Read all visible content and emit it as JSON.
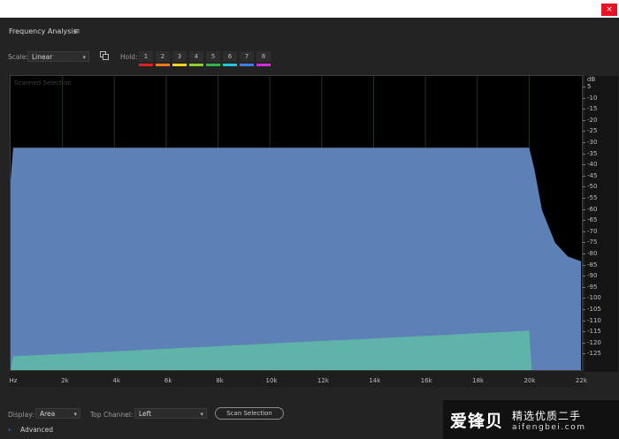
{
  "window": {
    "close_glyph": "×"
  },
  "panel": {
    "title": "Frequency Analysis",
    "menu_icon": "≡"
  },
  "controls": {
    "scale_label": "Scale:",
    "scale_value": "Linear",
    "hold_label": "Hold:",
    "hold_buttons": [
      {
        "label": "1",
        "color": "#e0201c"
      },
      {
        "label": "2",
        "color": "#f07a1a"
      },
      {
        "label": "3",
        "color": "#f2d21a"
      },
      {
        "label": "4",
        "color": "#8bd12a"
      },
      {
        "label": "5",
        "color": "#2fb34a"
      },
      {
        "label": "6",
        "color": "#20c6d9"
      },
      {
        "label": "7",
        "color": "#3b7fe6"
      },
      {
        "label": "8",
        "color": "#d62ad6"
      }
    ]
  },
  "plot": {
    "overlay_label": "Scanned Selection",
    "db_unit": "dB",
    "db_ticks": [
      "5",
      "-10",
      "-15",
      "-20",
      "-25",
      "-30",
      "-35",
      "-40",
      "-45",
      "-50",
      "-55",
      "-60",
      "-65",
      "-70",
      "-75",
      "-80",
      "-85",
      "-90",
      "-95",
      "-100",
      "-105",
      "-110",
      "-115",
      "-120",
      "-125"
    ],
    "freq_ticks": [
      "Hz",
      "2k",
      "4k",
      "6k",
      "8k",
      "10k",
      "12k",
      "14k",
      "16k",
      "18k",
      "20k",
      "22k"
    ],
    "colors": {
      "background": "#000000",
      "area": "#5d80b6",
      "top_channel": "#5fb3a8",
      "grid": "#1c3a1c"
    }
  },
  "chart_data": {
    "type": "area",
    "xlabel": "",
    "ylabel": "dB",
    "xlim": [
      0,
      22000
    ],
    "ylim": [
      -127,
      0
    ],
    "series": [
      {
        "x": [
          0,
          100,
          200,
          20000,
          20200,
          20500,
          21000,
          21500,
          22000
        ],
        "y": [
          -45,
          -31,
          -31,
          -31,
          -40,
          -58,
          -72,
          -78,
          -80
        ]
      },
      {
        "x": [
          0,
          100,
          200,
          20000,
          20100
        ],
        "y": [
          -127,
          -121,
          -121,
          -110,
          -127
        ]
      }
    ]
  },
  "bottom": {
    "display_label": "Display:",
    "display_value": "Area",
    "top_channel_label": "Top Channel:",
    "top_channel_value": "Left",
    "scan_button": "Scan Selection",
    "advanced_label": "Advanced",
    "advanced_chevron": "›"
  },
  "watermark": {
    "logo": "爱锋贝",
    "tagline": "精选优质二手",
    "url": "aifengbei.com"
  }
}
